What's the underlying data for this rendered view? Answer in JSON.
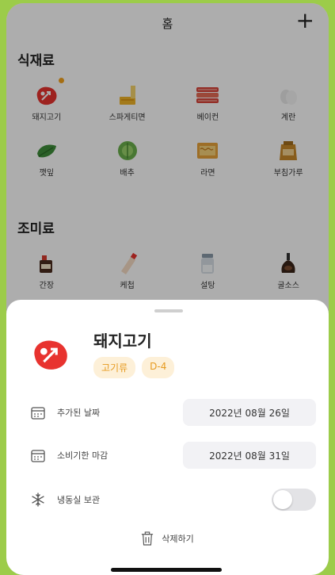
{
  "header": {
    "title": "홈",
    "add_label": "+"
  },
  "sections": {
    "ingredients_title": "식재료",
    "seasonings_title": "조미료"
  },
  "ingredients": [
    {
      "label": "돼지고기",
      "icon": "steak-icon",
      "new": true
    },
    {
      "label": "스파게티면",
      "icon": "pasta-icon"
    },
    {
      "label": "베이컨",
      "icon": "bacon-icon"
    },
    {
      "label": "계란",
      "icon": "egg-icon"
    },
    {
      "label": "깻잎",
      "icon": "leaf-icon"
    },
    {
      "label": "배추",
      "icon": "cabbage-icon"
    },
    {
      "label": "라면",
      "icon": "ramen-icon"
    },
    {
      "label": "부침가루",
      "icon": "flour-bag-icon"
    }
  ],
  "seasonings": [
    {
      "label": "간장",
      "icon": "soy-sauce-icon"
    },
    {
      "label": "케첩",
      "icon": "ketchup-icon"
    },
    {
      "label": "설탕",
      "icon": "sugar-jar-icon"
    },
    {
      "label": "굴소스",
      "icon": "oyster-sauce-icon"
    }
  ],
  "sheet": {
    "title": "돼지고기",
    "tags": [
      "고기류",
      "D-4"
    ],
    "added_date_label": "추가된 날짜",
    "added_date_value": "2022년 08월 26일",
    "expiry_label": "소비기한 마감",
    "expiry_value": "2022년 08월 31일",
    "freezer_label": "냉동실 보관",
    "freezer_on": false,
    "delete_label": "삭제하기"
  },
  "colors": {
    "accent": "#f3a21d",
    "tag_bg": "#fdf0d8",
    "meat_red": "#e8332f",
    "frame_green": "#9ccc4a"
  }
}
